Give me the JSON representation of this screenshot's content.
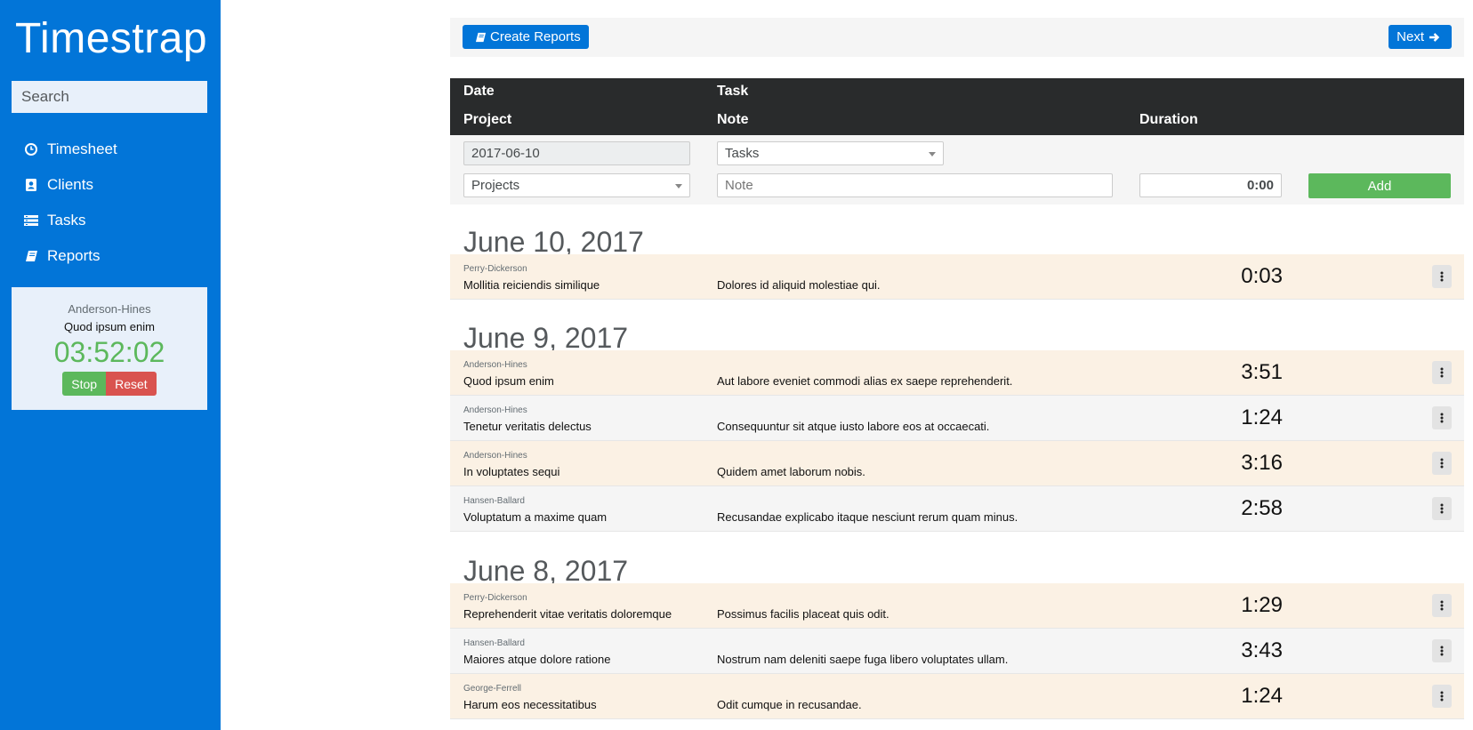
{
  "app": {
    "title": "Timestrap"
  },
  "search": {
    "placeholder": "Search"
  },
  "nav": {
    "items": [
      {
        "label": "Timesheet",
        "icon": "clock-icon"
      },
      {
        "label": "Clients",
        "icon": "contacts-icon"
      },
      {
        "label": "Tasks",
        "icon": "list-icon"
      },
      {
        "label": "Reports",
        "icon": "book-icon"
      }
    ]
  },
  "timer": {
    "client": "Anderson-Hines",
    "task": "Quod ipsum enim",
    "elapsed": "03:52:02",
    "stop_label": "Stop",
    "reset_label": "Reset"
  },
  "toolbar": {
    "create_label": "Create Reports",
    "next_label": "Next"
  },
  "table_header": {
    "date": "Date",
    "task": "Task",
    "project": "Project",
    "note": "Note",
    "duration": "Duration"
  },
  "entry_form": {
    "date_value": "2017-06-10",
    "tasks_value": "Tasks",
    "projects_value": "Projects",
    "note_placeholder": "Note",
    "duration_value": "0:00",
    "add_label": "Add"
  },
  "days": [
    {
      "heading": "June 10, 2017",
      "entries": [
        {
          "client": "Perry-Dickerson",
          "task": "Mollitia reiciendis similique",
          "note": "Dolores id aliquid molestiae qui.",
          "duration": "0:03"
        }
      ]
    },
    {
      "heading": "June 9, 2017",
      "entries": [
        {
          "client": "Anderson-Hines",
          "task": "Quod ipsum enim",
          "note": "Aut labore eveniet commodi alias ex saepe reprehenderit.",
          "duration": "3:51"
        },
        {
          "client": "Anderson-Hines",
          "task": "Tenetur veritatis delectus",
          "note": "Consequuntur sit atque iusto labore eos at occaecati.",
          "duration": "1:24"
        },
        {
          "client": "Anderson-Hines",
          "task": "In voluptates sequi",
          "note": "Quidem amet laborum nobis.",
          "duration": "3:16"
        },
        {
          "client": "Hansen-Ballard",
          "task": "Voluptatum a maxime quam",
          "note": "Recusandae explicabo itaque nesciunt rerum quam minus.",
          "duration": "2:58"
        }
      ]
    },
    {
      "heading": "June 8, 2017",
      "entries": [
        {
          "client": "Perry-Dickerson",
          "task": "Reprehenderit vitae veritatis doloremque",
          "note": "Possimus facilis placeat quis odit.",
          "duration": "1:29"
        },
        {
          "client": "Hansen-Ballard",
          "task": "Maiores atque dolore ratione",
          "note": "Nostrum nam deleniti saepe fuga libero voluptates ullam.",
          "duration": "3:43"
        },
        {
          "client": "George-Ferrell",
          "task": "Harum eos necessitatibus",
          "note": "Odit cumque in recusandae.",
          "duration": "1:24"
        }
      ]
    }
  ],
  "colors": {
    "sidebar": "#0275d8",
    "header": "#292b2c",
    "success": "#5cb85c",
    "danger": "#d9534f",
    "row_highlight": "#fbf1e4"
  }
}
